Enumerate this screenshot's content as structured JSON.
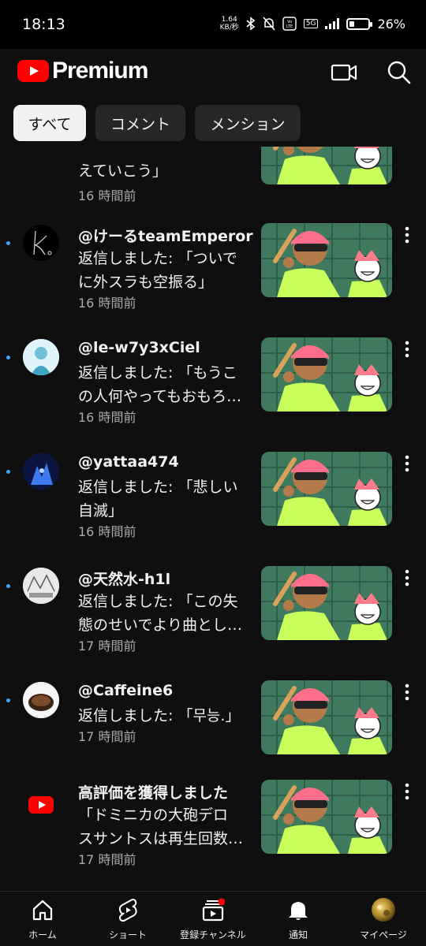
{
  "status_bar": {
    "time": "18:13",
    "net_speed_value": "1.64",
    "net_speed_unit": "KB/秒",
    "network": "5G",
    "battery": "26%",
    "battery_level": 0.26
  },
  "header": {
    "logo_text": "Premium",
    "brand_color": "#ff0000",
    "cast_icon": "video-camera-icon",
    "search_icon": "search-icon"
  },
  "chips": [
    {
      "label": "すべて",
      "active": true
    },
    {
      "label": "コメント",
      "active": false
    },
    {
      "label": "メンション",
      "active": false
    }
  ],
  "notifications": [
    {
      "title": "",
      "body_lines": [
        "えていこう」"
      ],
      "time": "16 時間前",
      "unread": false
    },
    {
      "title": "@けーるteamEmperor",
      "body_lines": [
        "返信しました: 「ついで",
        "に外スラも空振る」"
      ],
      "time": "16 時間前",
      "unread": true
    },
    {
      "title": "@le-w7y3xCiel",
      "body_lines": [
        "返信しました: 「もうこ",
        "の人何やってもおもろ…"
      ],
      "time": "16 時間前",
      "unread": true
    },
    {
      "title": "@yattaa474",
      "body_lines": [
        "返信しました: 「悲しい",
        "自滅」"
      ],
      "time": "16 時間前",
      "unread": true
    },
    {
      "title": "@天然水-h1l",
      "body_lines": [
        "返信しました: 「この失",
        "態のせいでより曲とし…"
      ],
      "time": "17 時間前",
      "unread": true
    },
    {
      "title": "@Caffeine6",
      "body_lines": [
        "返信しました: 「무능.」"
      ],
      "time": "17 時間前",
      "unread": true
    },
    {
      "title": "高評価を獲得しました",
      "body_lines": [
        "「ドミニカの大砲デロ",
        "スサントスは再生回数…"
      ],
      "time": "17 時間前",
      "unread": false
    }
  ],
  "bottom_nav": [
    {
      "label": "ホーム",
      "icon": "home-icon"
    },
    {
      "label": "ショート",
      "icon": "shorts-icon"
    },
    {
      "label": "登録チャンネル",
      "icon": "subscriptions-icon",
      "badge": true
    },
    {
      "label": "通知",
      "icon": "bell-icon"
    },
    {
      "label": "マイページ",
      "icon": "profile-avatar"
    }
  ],
  "colors": {
    "background": "#0f0f0f",
    "chip": "#272727",
    "unread_dot": "#3ea6ff",
    "secondary_text": "#aaaaaa"
  }
}
